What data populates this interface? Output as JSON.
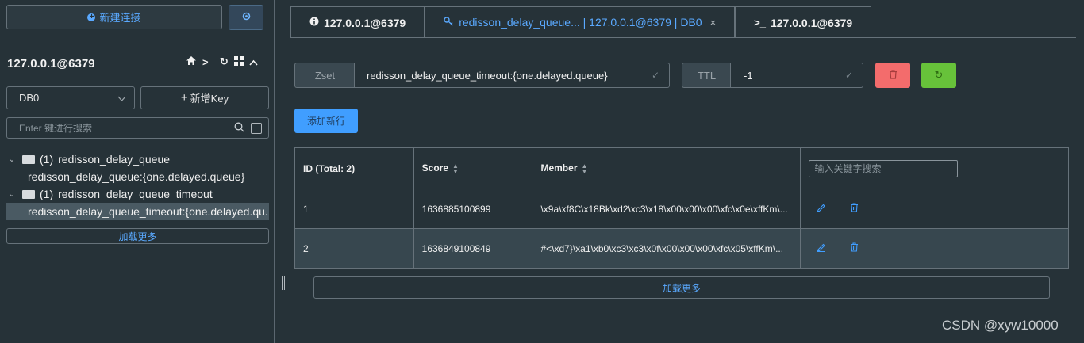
{
  "sidebar": {
    "new_connection_label": "新建连接",
    "connection_name": "127.0.0.1@6379",
    "db_select_value": "DB0",
    "add_key_label": "新增Key",
    "search_placeholder": "Enter 键进行搜索",
    "tree": [
      {
        "count": "(1)",
        "name": "redisson_delay_queue",
        "child": "redisson_delay_queue:{one.delayed.queue}",
        "selected": false
      },
      {
        "count": "(1)",
        "name": "redisson_delay_queue_timeout",
        "child": "redisson_delay_queue_timeout:{one.delayed.qu...",
        "selected": true
      }
    ],
    "load_more_label": "加载更多"
  },
  "tabs": [
    {
      "label": "127.0.0.1@6379",
      "icon": "info-icon"
    },
    {
      "label": "redisson_delay_queue... | 127.0.0.1@6379 | DB0",
      "icon": "key-icon",
      "active": true
    },
    {
      "label": "127.0.0.1@6379",
      "icon": "terminal-icon"
    }
  ],
  "key_bar": {
    "type_label": "Zset",
    "key_name": "redisson_delay_queue_timeout:{one.delayed.queue}",
    "ttl_label": "TTL",
    "ttl_value": "-1"
  },
  "add_row_label": "添加新行",
  "table": {
    "headers": {
      "id": "ID (Total: 2)",
      "score": "Score",
      "member": "Member",
      "filter_placeholder": "输入关键字搜索"
    },
    "rows": [
      {
        "id": "1",
        "score": "1636885100899",
        "member": "\\x9a\\xf8C\\x18Bk\\xd2\\xc3\\x18\\x00\\x00\\x00\\xfc\\x0e\\xffKm\\..."
      },
      {
        "id": "2",
        "score": "1636849100849",
        "member": "#<\\xd7}\\xa1\\xb0\\xc3\\xc3\\x0f\\x00\\x00\\x00\\xfc\\x05\\xffKm\\..."
      }
    ]
  },
  "main_load_more_label": "加载更多",
  "watermark": "CSDN @xyw10000",
  "colors": {
    "accent": "#409eff",
    "danger": "#f36c6c",
    "success": "#67c23a",
    "background": "#263238"
  }
}
